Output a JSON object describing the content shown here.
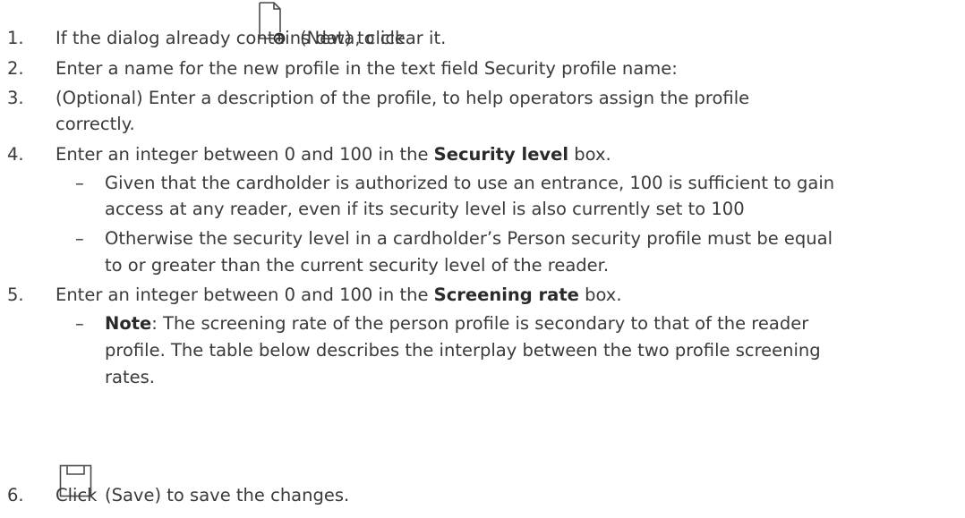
{
  "steps": [
    {
      "number": "1.",
      "before_icon": "If the dialog already contains data, click",
      "icon": "new-document-icon",
      "after_icon": "(New) to clear it."
    },
    {
      "number": "2.",
      "text": "Enter a name for the new profile in the text field Security profile name:"
    },
    {
      "number": "3.",
      "line1": "(Optional) Enter a description of the profile, to help operators assign the profile",
      "line2": "correctly."
    },
    {
      "number": "4.",
      "before_bold": "Enter an integer between 0 and 100 in the",
      "bold": "Security level",
      "after_bold": "box."
    },
    {
      "number": "5.",
      "before_bold": "Enter an integer between 0 and 100 in the",
      "bold": "Screening rate",
      "after_bold": "box."
    },
    {
      "number": "6.",
      "before_icon": "Click",
      "icon": "save-icon",
      "after_icon": "(Save) to save the changes."
    }
  ],
  "step4_sub": [
    {
      "dash": "–",
      "line1": "Given that the cardholder is authorized to use an entrance, 100 is sufficient to gain",
      "line2": "access at any reader, even if its security level is also currently set to 100"
    },
    {
      "dash": "–",
      "line1": "Otherwise the security level in a cardholder’s Person security profile must be equal",
      "line2": "to or greater than the current security level of the reader."
    }
  ],
  "step5_sub": [
    {
      "dash": "–",
      "bold": "Note",
      "line1_rest": ": The screening rate of the person profile is secondary to that of the reader",
      "line2": "profile. The table below describes the interplay between the two profile screening",
      "line3": "rates."
    }
  ]
}
